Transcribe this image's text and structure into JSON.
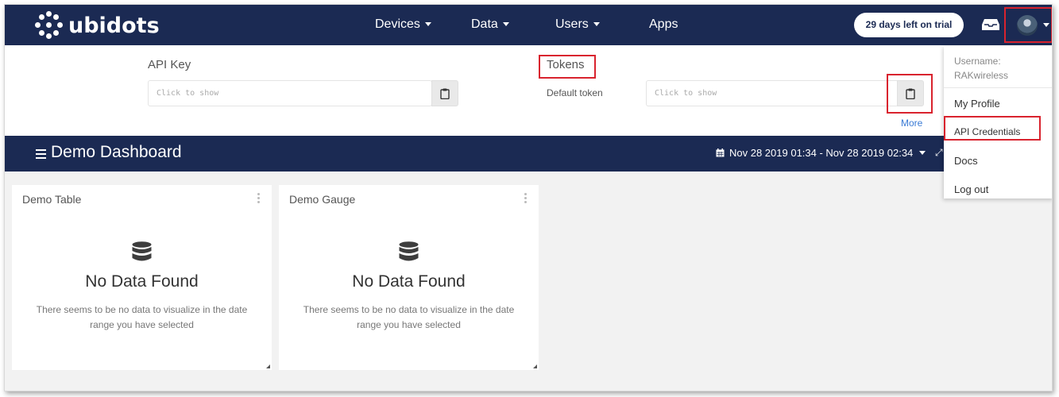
{
  "nav": {
    "logo_text": "ubidots",
    "items": [
      {
        "label": "Devices",
        "has_caret": true
      },
      {
        "label": "Data",
        "has_caret": true
      },
      {
        "label": "Users",
        "has_caret": true
      },
      {
        "label": "Apps",
        "has_caret": false
      }
    ],
    "trial_badge": "29 days left on trial",
    "inbox_icon": "inbox-icon",
    "avatar_icon": "user-avatar"
  },
  "credentials": {
    "api_key_label": "API Key",
    "api_key_placeholder": "Click to show",
    "tokens_label": "Tokens",
    "default_token_label": "Default token",
    "default_token_placeholder": "Click to show",
    "more_link": "More",
    "copy_icon": "clipboard-icon"
  },
  "dashboard": {
    "title": "Demo Dashboard",
    "date_range": "Nov 28 2019 01:34 - Nov 28 2019 02:34",
    "calendar_icon": "calendar-icon",
    "widgets": [
      {
        "title": "Demo Table",
        "empty_title": "No Data Found",
        "empty_text": "There seems to be no data to visualize in the date range you have selected"
      },
      {
        "title": "Demo Gauge",
        "empty_title": "No Data Found",
        "empty_text": "There seems to be no data to visualize in the date range you have selected"
      }
    ]
  },
  "user_menu": {
    "username_label": "Username:",
    "username": "RAKwireless",
    "items": [
      "My Profile",
      "API Credentials",
      "Docs",
      "Log out"
    ]
  },
  "colors": {
    "navy": "#1b2a53",
    "highlight_red": "#d9232e",
    "link_blue": "#3a7bd5"
  }
}
